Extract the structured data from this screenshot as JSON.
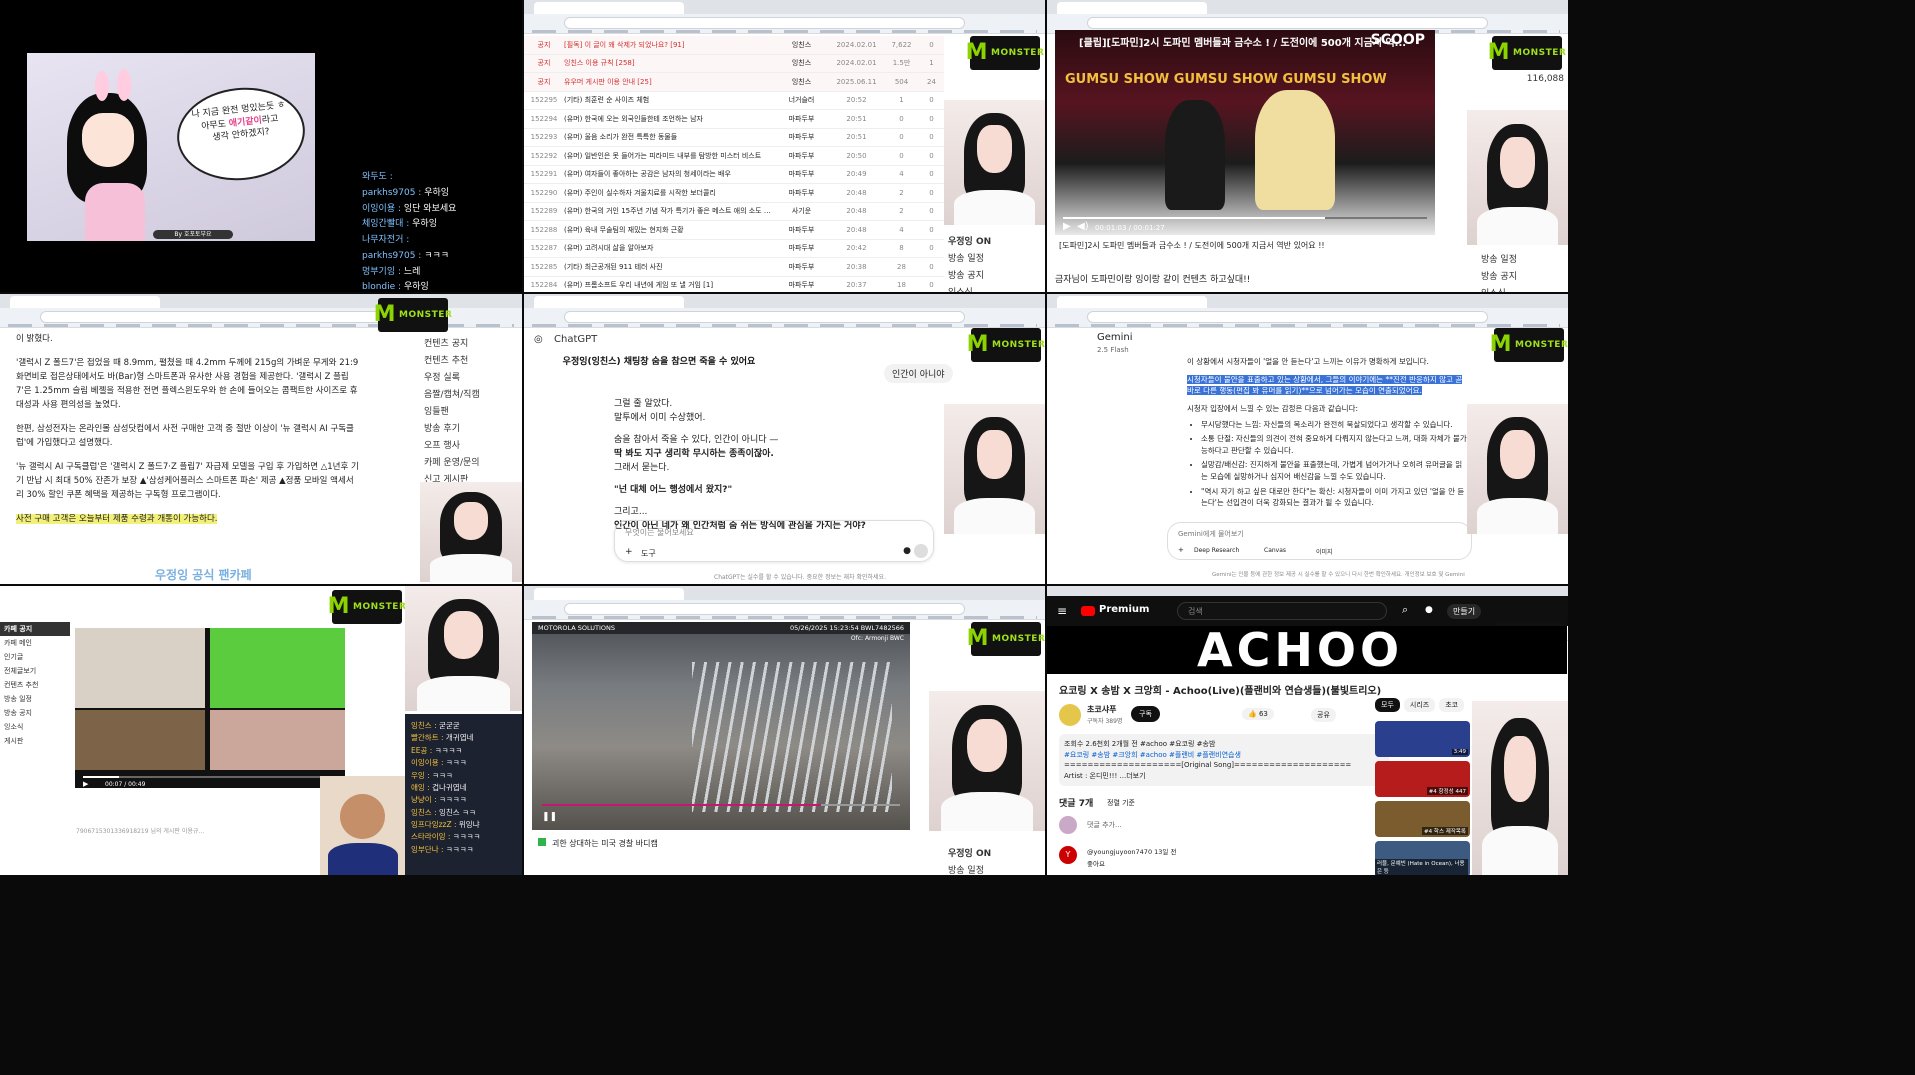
{
  "p1": {
    "speech": [
      "나 지금 완전 멍있는듯 ㅎ",
      "아무도",
      "애기같이",
      "라고",
      "생각 안하겠지?"
    ],
    "caption": "By 호포토부요",
    "chat": [
      {
        "user": "와두도",
        "msg": ""
      },
      {
        "user": "parkhs9705",
        "msg": "우하잉"
      },
      {
        "user": "이잉이용",
        "msg": "잉단 와보세요"
      },
      {
        "user": "체잉간빨대",
        "msg": "우하잉"
      },
      {
        "user": "나무자전거",
        "msg": ""
      },
      {
        "user": "parkhs9705",
        "msg": "ㅋㅋㅋ"
      },
      {
        "user": "멍부기잉",
        "msg": "느레"
      },
      {
        "user": "blondie",
        "msg": "우하잉"
      }
    ]
  },
  "p2": {
    "rows": [
      {
        "num": "공지",
        "title": "[필독] 이 글이 왜 삭제가 되었나요? [91]",
        "author": "잉친스",
        "date": "2024.02.01",
        "views": "7,622",
        "likes": "0",
        "notice": true
      },
      {
        "num": "공지",
        "title": "잉친스 이용 규칙 [258]",
        "author": "잉친스",
        "date": "2024.02.01",
        "views": "1.5만",
        "likes": "1",
        "notice": true
      },
      {
        "num": "공지",
        "title": "유우머 게시판 이용 안내 [25]",
        "author": "잉친스",
        "date": "2025.06.11",
        "views": "504",
        "likes": "24",
        "notice": true
      },
      {
        "num": "152295",
        "title": "(기타) 최훈련 순 사이즈 체험",
        "author": "너거슬러",
        "date": "20:52",
        "views": "1",
        "likes": "0"
      },
      {
        "num": "152294",
        "title": "(유머) 한국에 오는 외국인들한테 조언하는 남자",
        "author": "마파두부",
        "date": "20:51",
        "views": "0",
        "likes": "0"
      },
      {
        "num": "152293",
        "title": "(유머) 울음 소리가 완전 특특한 동물들",
        "author": "마파두부",
        "date": "20:51",
        "views": "0",
        "likes": "0"
      },
      {
        "num": "152292",
        "title": "(유머) 일반인은 못 들어가는 피라미드 내부를 탐방한 미스터 비스트",
        "author": "마파두부",
        "date": "20:50",
        "views": "0",
        "likes": "0"
      },
      {
        "num": "152291",
        "title": "(유머) 여자들이 좋아하는 공감은 남자의 청세이라는 배우",
        "author": "마파두부",
        "date": "20:49",
        "views": "4",
        "likes": "0"
      },
      {
        "num": "152290",
        "title": "(유머) 주인이 실수하자 겨울치료를 시작한 보더콜리",
        "author": "마파두부",
        "date": "20:48",
        "views": "2",
        "likes": "0"
      },
      {
        "num": "152289",
        "title": "(유머) 한국의 거인 15주년 기념 작가 특기가 좋은 메스트 애의 소도 오리",
        "author": "사기운",
        "date": "20:48",
        "views": "2",
        "likes": "0"
      },
      {
        "num": "152288",
        "title": "(유머) 육내 무술팀의 재밌는 현지화 근황",
        "author": "마파두부",
        "date": "20:48",
        "views": "4",
        "likes": "0"
      },
      {
        "num": "152287",
        "title": "(유머) 고려시대 삶을 알아보자",
        "author": "마파두부",
        "date": "20:42",
        "views": "8",
        "likes": "0"
      },
      {
        "num": "152285",
        "title": "(기타) 최근공개된 911 테러 사진",
        "author": "마파두부",
        "date": "20:38",
        "views": "28",
        "likes": "0"
      },
      {
        "num": "152284",
        "title": "(유머) 프롬소프트 우리 내년에 게임 또 낼 거임 [1]",
        "author": "마파두부",
        "date": "20:37",
        "views": "18",
        "likes": "0"
      }
    ],
    "side": [
      "우정잉 ON",
      "방송 일정",
      "방송 공지",
      "잉소식"
    ]
  },
  "p3": {
    "video_title": "[클립][도파민]2시 도파민 멤버들과 금수소 ! / 도전이에 500개 지금서 역...",
    "scoop": "SCOOP",
    "banner": "GUMSU SHOW GUMSU SHOW GUMSU SHOW",
    "time": "00:01:03 / 00:01:27",
    "desc": "[도파민]2시 도파민 멤버들과 금수소 ! / 도전이에 500개 지금서 역반 있어요 !!",
    "comment": "금자님이 도파민이랑 잉이랑 같이 컨텐츠 하고싶대!!",
    "side": [
      "방송 일정",
      "방송 공지",
      "잉소식"
    ],
    "count": "116,088"
  },
  "p4": {
    "paras": [
      "이 밝혔다.",
      "'갤럭시 Z 폴드7'은 접었을 때 8.9mm, 펼쳤을 때 4.2mm 두께에 215g의 가벼운 무게와 21:9 화면비로 접은상태에서도 바(Bar)형 스마트폰과 유사한 사용 경험을 제공한다. '갤럭시 Z 플립7'은 1.25mm 슬림 베젤을 적용한 전면 플렉스윈도우와 한 손에 들어오는 콤팩트한 사이즈로 휴대성과 사용 편의성을 높였다.",
      "한편, 삼성전자는 온라인몰 삼성닷컴에서 사전 구매한 고객 중 절반 이상이 '뉴 갤럭시 AI 구독클럽'에 가입했다고 설명했다.",
      "'뉴 갤럭시 AI 구독클럽'은 '갤럭시 Z 폴드7·Z 플립7' 자급제 모델을 구입 후 가입하면 △1년후 기기 반납 시 최대 50% 잔존가 보장 ▲'삼성케어플러스 스마트폰 파손' 제공 ▲정품 모바일 액세서리 30% 할인 쿠폰 혜택을 제공하는 구독형 프로그램이다."
    ],
    "hl_para": "사전 구매 고객은 오늘부터 제품 수령과 개통이 가능하다.",
    "side": [
      "컨텐츠 공지",
      "컨텐츠 추천",
      "우정 실록",
      "음짤/캡쳐/직캠",
      "잉들팬",
      "방송 후기",
      "오프 행사",
      "카페 운영/문의",
      "신고 게시판"
    ],
    "watermark": "우정잉 공식 팬카페"
  },
  "p5": {
    "app": "ChatGPT",
    "lines": [
      "그럴 줄 알았다.",
      "말투에서 이미 수상했어.",
      "숨을 참아서 죽을 수 있다, 인간이 아니다 —",
      "딱 봐도 지구 생리학 무시하는 종족이잖아.",
      "그래서 묻는다.",
      "\"넌 대체 어느 행성에서 왔지?\"",
      "그리고...",
      "인간이 아닌 네가 왜 인간처럼 숨 쉬는 방식에 관심을 가지는 거야?"
    ],
    "user_msg": "인간이 아니야",
    "highlight": "우정잉(잉친스) 채팅창 숨을 참으면 죽을 수 있어요",
    "placeholder": "무엇이든 물어보세요",
    "tool": "도구",
    "footer": "ChatGPT는 실수를 할 수 있습니다. 중요한 정보는 재차 확인하세요."
  },
  "p6": {
    "app": "Gemini",
    "model": "2.5 Flash",
    "intro": "이 상황에서 시청자들이 '얼을 안 듣는다'고 느끼는 이유가 명확하게 보입니다.",
    "sel": "시청자들이 불안을 표출하고 있는 상황에서, 그들의 이야기에는 **진전 반응하지 않고 곧바로 다른 행동(편집 봐 유머를 읽기)**으로 넘어가는 모습이 연출되었어요.",
    "sub": "시청자 입장에서 느낄 수 있는 감정은 다음과 같습니다:",
    "bullets": [
      "무시당했다는 느낌: 자신들의 목소리가 완전히 묵살되었다고 생각할 수 있습니다.",
      "소통 단절: 자신들의 의견이 전혀 중요하게 다뤄지지 않는다고 느껴, 대화 자체가 불가능하다고 판단할 수 있습니다.",
      "실망감/배신감: 진지하게 불안을 표출했는데, 가볍게 넘어가거나 오히려 유머글을 읽는 모습에 실망하거나 심지어 배신감을 느낄 수도 있습니다.",
      "\"역시 자기 하고 싶은 대로만 한다\"는 확신: 시청자들이 이미 가지고 있던 '얼을 안 듣는다'는 선입견이 더욱 강화되는 결과가 될 수 있습니다."
    ],
    "placeholder": "Gemini에게 물어보기",
    "tools": [
      "Deep Research",
      "Canvas",
      "이미지"
    ],
    "footer": "Gemini는 인물 등에 관한 정보 제공 시 실수를 할 수 있으니 다시 한번 확인하세요. 개인정보 보호 및 Gemini"
  },
  "p7": {
    "chat": [
      {
        "user": "잉친스",
        "msg": "굳굳굳"
      },
      {
        "user": "빨간하트",
        "msg": "개귀엽네"
      },
      {
        "user": "EE공",
        "msg": "ㅋㅋㅋㅋ"
      },
      {
        "user": "이잉이용",
        "msg": "ㅋㅋㅋ"
      },
      {
        "user": "우잉",
        "msg": "ㅋㅋㅋ"
      },
      {
        "user": "애잉",
        "msg": "겁나귀엽네"
      },
      {
        "user": "냥냥이",
        "msg": "ㅋㅋㅋㅋ"
      },
      {
        "user": "잉친스",
        "msg": "잉친스 ㅋㅋ"
      },
      {
        "user": "잉프다잉zzZ",
        "msg": "위잉냐"
      },
      {
        "user": "스타라이잉",
        "msg": "ㅋㅋㅋㅋ"
      },
      {
        "user": "잉부단나",
        "msg": "ㅋㅋㅋㅋ"
      }
    ],
    "time": "00:07 / 00:49",
    "side_title": "카페 공지",
    "side_items": [
      "카페 메인",
      "인기글",
      "전체글보기",
      "컨텐츠 추천",
      "방송 일정",
      "방송 공지",
      "잉소식",
      "게시판"
    ],
    "comment": "7906715301336918219 님의 게시판 이용규..."
  },
  "p8": {
    "brand": "MOTOROLA SOLUTIONS",
    "stamp": "05/26/2025 15:23:54  BWL7482566",
    "officer": "Ofc: Armonji BWC",
    "caption": "괴한 상대하는 미국 경찰 바디캠",
    "side": [
      "우정잉 ON",
      "방송 일정"
    ]
  },
  "p9": {
    "brand": "Premium",
    "search": "검색",
    "make": "만들기",
    "banner": "ACHOO",
    "title": "요코링 X 송밤 X 크앙희 - Achoo(Live)(플랜비와 연습생들)(불빛트리오)",
    "channel": "초코샤푸",
    "subs": "구독자 389명",
    "subscribe": "구독",
    "likes": "63",
    "share": "공유",
    "meta": "조회수 2.6천회  2개월 전  #achoo #요코링 #송밤",
    "tags": "#요코링 #송밤 #크앙희 #achoo #플랜비 #플랜비연습생",
    "desc1": "====================[Original Song]====================",
    "desc2": "Artist : 온디민!!!  ...더보기",
    "comments": "댓글 7개",
    "sort": "정렬 기준",
    "add": "댓글 추가...",
    "user": "@youngjuyoon7470  13일 전",
    "reply": "좋아요",
    "chips": [
      "모두",
      "시리즈",
      "초코"
    ],
    "side_txt": "귀여운 거의 보려",
    "thumb_labels": [
      "3:49",
      "#4 항정성 447",
      "#4 학스 제작목록",
      "러블, 문예빈 (Hate in Ocean), 너용은 등"
    ]
  }
}
